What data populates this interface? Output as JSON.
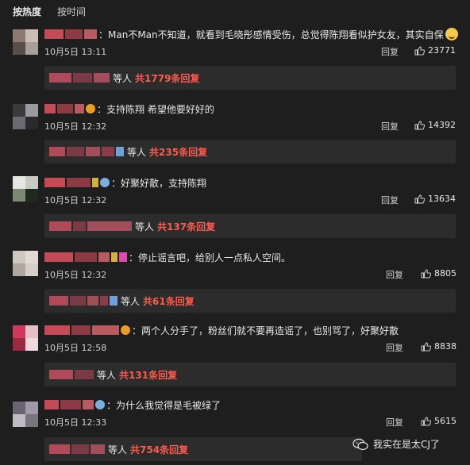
{
  "tabs": {
    "hot": "按热度",
    "time": "按时间"
  },
  "comments": [
    {
      "text": "Man不Man不知道，就看到毛晓彤感情受伤，总觉得陈翔看似护女友，其实自保",
      "date": "10月5日 13:11",
      "reply": "回复",
      "likes": "23771",
      "sub_deng": "等人",
      "sub_count": "共1779条回复"
    },
    {
      "text": "支持陈翔 希望他要好好的",
      "date": "10月5日 12:32",
      "reply": "回复",
      "likes": "14392",
      "sub_deng": "等人",
      "sub_count": "共235条回复"
    },
    {
      "text": "好聚好散，支持陈翔",
      "date": "10月5日 12:32",
      "reply": "回复",
      "likes": "13634",
      "sub_deng": "等人",
      "sub_count": "共137条回复"
    },
    {
      "text": "停止谣言吧，给别人一点私人空间。",
      "date": "10月5日 12:32",
      "reply": "回复",
      "likes": "8805",
      "sub_deng": "等人",
      "sub_count": "共61条回复"
    },
    {
      "text": "两个人分手了，粉丝们就不要再造谣了，也别骂了，好聚好散",
      "date": "10月5日 12:58",
      "reply": "回复",
      "likes": "8838",
      "sub_deng": "等人",
      "sub_count": "共131条回复"
    },
    {
      "text": "为什么我觉得是毛被绿了",
      "date": "10月5日 12:33",
      "reply": "回复",
      "likes": "5615",
      "sub_deng": "等人",
      "sub_count": "共754条回复"
    }
  ],
  "watermark": "我实在是太CJ了"
}
